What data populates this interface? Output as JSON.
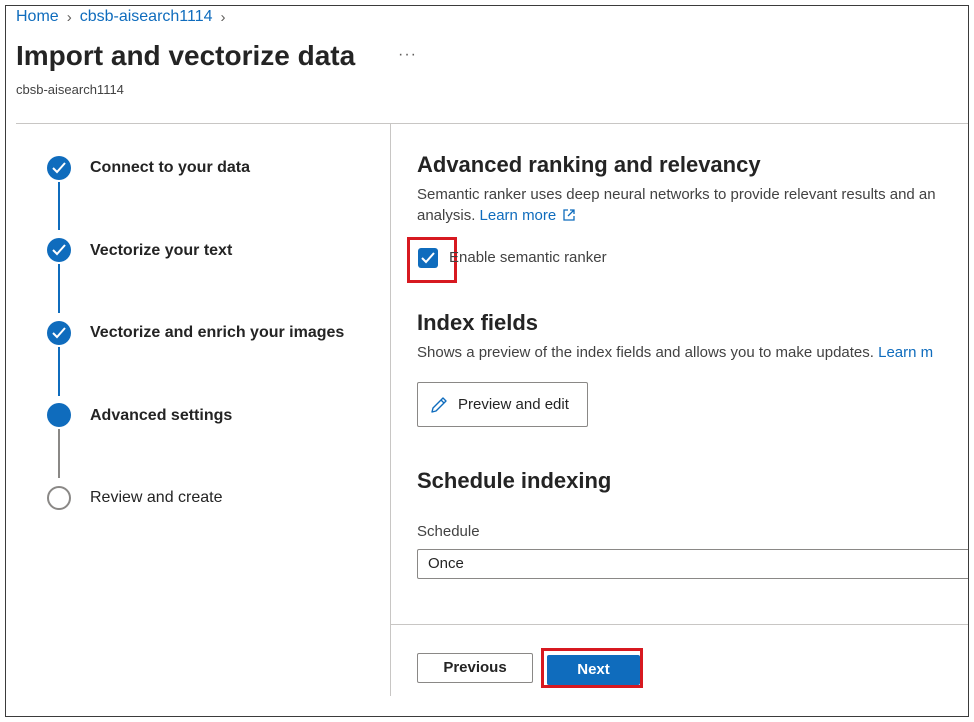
{
  "breadcrumb": {
    "items": [
      "Home",
      "cbsb-aisearch1114"
    ],
    "separator": ">"
  },
  "header": {
    "title": "Import and vectorize data",
    "more_label": "···",
    "subtitle": "cbsb-aisearch1114"
  },
  "wizard": {
    "steps": [
      {
        "label": "Connect to your data",
        "status": "completed"
      },
      {
        "label": "Vectorize your text",
        "status": "completed"
      },
      {
        "label": "Vectorize and enrich your images",
        "status": "completed"
      },
      {
        "label": "Advanced settings",
        "status": "current"
      },
      {
        "label": "Review and create",
        "status": "pending"
      }
    ]
  },
  "ranking": {
    "heading": "Advanced ranking and relevancy",
    "description_line1": "Semantic ranker uses deep neural networks to provide relevant results and an",
    "description_line2": "analysis.",
    "learn_more": "Learn more",
    "checkbox_label": "Enable semantic ranker",
    "checkbox_checked": true
  },
  "index_fields": {
    "heading": "Index fields",
    "description": "Shows a preview of the index fields and allows you to make updates.",
    "learn_more": "Learn m",
    "preview_button": "Preview and edit"
  },
  "schedule": {
    "heading": "Schedule indexing",
    "field_label": "Schedule",
    "selected_value": "Once"
  },
  "footer": {
    "previous_label": "Previous",
    "next_label": "Next"
  },
  "colors": {
    "accent": "#0f6cbd",
    "highlight": "#d71920"
  }
}
